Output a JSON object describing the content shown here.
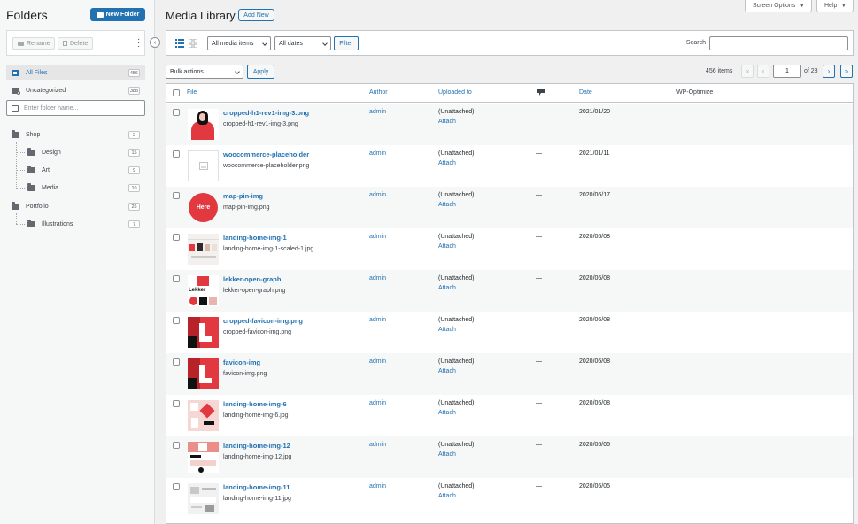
{
  "sidebar": {
    "title": "Folders",
    "new_folder_label": "New Folder",
    "rename_label": "Rename",
    "delete_label": "Delete",
    "all_files": {
      "label": "All Files",
      "count": "456"
    },
    "uncategorized": {
      "label": "Uncategorized",
      "count": "388"
    },
    "folder_input_placeholder": "Enter folder name...",
    "tree": [
      {
        "label": "Shop",
        "count": "2"
      },
      {
        "label": "Design",
        "count": "15"
      },
      {
        "label": "Art",
        "count": "9"
      },
      {
        "label": "Media",
        "count": "10"
      },
      {
        "label": "Portfolio",
        "count": "25"
      },
      {
        "label": "Illustrations",
        "count": "7"
      }
    ]
  },
  "header": {
    "title": "Media Library",
    "add_new_label": "Add New",
    "screen_options_label": "Screen Options",
    "help_label": "Help"
  },
  "filters": {
    "type_select": "All media items",
    "date_select": "All dates",
    "filter_label": "Filter",
    "search_label": "Search",
    "bulk_select": "Bulk actions",
    "apply_label": "Apply"
  },
  "pagination": {
    "items": "456 items",
    "first": "«",
    "prev": "‹",
    "current": "1",
    "of": "of 23",
    "next": "›",
    "last": "»"
  },
  "columns": {
    "file": "File",
    "author": "Author",
    "uploaded_to": "Uploaded to",
    "date": "Date",
    "wp_optimize": "WP-Optimize"
  },
  "rows": [
    {
      "title": "cropped-h1-rev1-img-3.png",
      "filename": "cropped-h1-rev1-img-3.png",
      "author": "admin",
      "uploaded": "(Unattached)",
      "attach": "Attach",
      "comments": "—",
      "date": "2021/01/20"
    },
    {
      "title": "woocommerce-placeholder",
      "filename": "woocommerce-placeholder.png",
      "author": "admin",
      "uploaded": "(Unattached)",
      "attach": "Attach",
      "comments": "—",
      "date": "2021/01/11"
    },
    {
      "title": "map-pin-img",
      "filename": "map-pin-img.png",
      "author": "admin",
      "uploaded": "(Unattached)",
      "attach": "Attach",
      "comments": "—",
      "date": "2020/06/17",
      "thumb_text": "Here"
    },
    {
      "title": "landing-home-img-1",
      "filename": "landing-home-img-1-scaled-1.jpg",
      "author": "admin",
      "uploaded": "(Unattached)",
      "attach": "Attach",
      "comments": "—",
      "date": "2020/06/08"
    },
    {
      "title": "lekker-open-graph",
      "filename": "lekker-open-graph.png",
      "author": "admin",
      "uploaded": "(Unattached)",
      "attach": "Attach",
      "comments": "—",
      "date": "2020/06/08",
      "thumb_text": "Lekker"
    },
    {
      "title": "cropped-favicon-img.png",
      "filename": "cropped-favicon-img.png",
      "author": "admin",
      "uploaded": "(Unattached)",
      "attach": "Attach",
      "comments": "—",
      "date": "2020/06/08"
    },
    {
      "title": "favicon-img",
      "filename": "favicon-img.png",
      "author": "admin",
      "uploaded": "(Unattached)",
      "attach": "Attach",
      "comments": "—",
      "date": "2020/06/08"
    },
    {
      "title": "landing-home-img-6",
      "filename": "landing-home-img-6.jpg",
      "author": "admin",
      "uploaded": "(Unattached)",
      "attach": "Attach",
      "comments": "—",
      "date": "2020/06/08"
    },
    {
      "title": "landing-home-img-12",
      "filename": "landing-home-img-12.jpg",
      "author": "admin",
      "uploaded": "(Unattached)",
      "attach": "Attach",
      "comments": "—",
      "date": "2020/06/05"
    },
    {
      "title": "landing-home-img-11",
      "filename": "landing-home-img-11.jpg",
      "author": "admin",
      "uploaded": "(Unattached)",
      "attach": "Attach",
      "comments": "—",
      "date": "2020/06/05"
    }
  ],
  "colors": {
    "accent": "#2271b1",
    "brand_red": "#e2383f"
  }
}
